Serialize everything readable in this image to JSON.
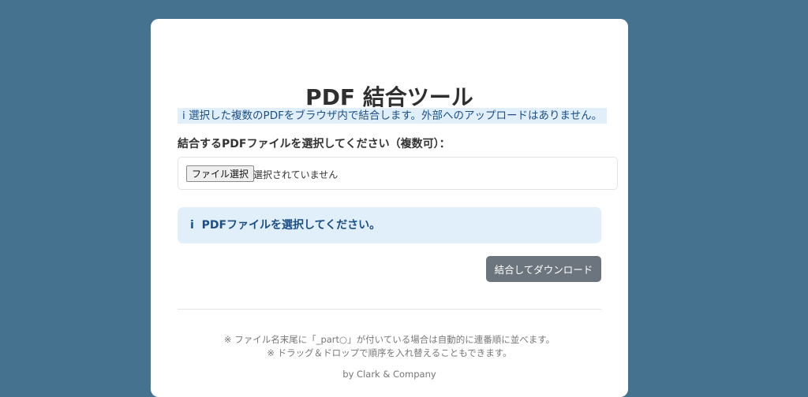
{
  "title": "PDF 結合ツール",
  "info_note": "選択した複数のPDFをブラウザ内で結合します。外部へのアップロードはありません。",
  "info_icon": "i",
  "file_label": "結合するPDFファイルを選択してください（複数可）：",
  "file_button": "ファイル選択",
  "file_status": "選択されていません",
  "alert_text": "PDFファイルを選択してください。",
  "download_button": "結合してダウンロード",
  "footer_note1": "※ ファイル名末尾に「_part○」が付いている場合は自動的に連番順に並べます。",
  "footer_note2": "※ ドラッグ＆ドロップで順序を入れ替えることもできます。",
  "credit": "by Clark & Company"
}
